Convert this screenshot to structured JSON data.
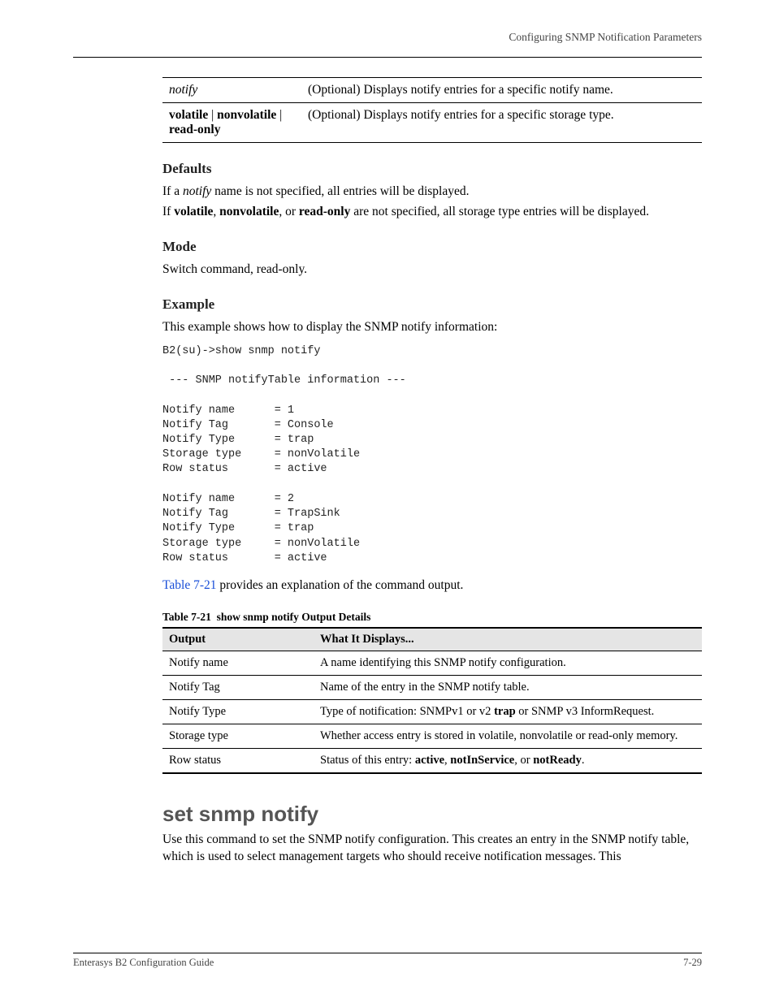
{
  "header": {
    "right_text": "Configuring SNMP Notification Parameters"
  },
  "param_table": {
    "rows": [
      {
        "key_html": "<span class=\"italic\">notify</span>",
        "desc": "(Optional) Displays notify entries for a specific notify name."
      },
      {
        "key_html": "<span class=\"bold\">volatile</span> | <span class=\"bold\">nonvolatile</span> | <span class=\"bold\">read-only</span>",
        "desc": "(Optional) Displays notify entries for a specific storage type."
      }
    ]
  },
  "defaults": {
    "heading": "Defaults",
    "line1_pre": "If a ",
    "line1_em": "notify",
    "line1_post": " name is not specified, all entries will be displayed.",
    "line2_pre": "If ",
    "line2_b1": "volatile",
    "line2_mid1": ", ",
    "line2_b2": "nonvolatile",
    "line2_mid2": ", or ",
    "line2_b3": "read-only",
    "line2_post": " are not specified, all storage type entries will be displayed."
  },
  "mode": {
    "heading": "Mode",
    "text": "Switch command, read-only."
  },
  "example": {
    "heading": "Example",
    "text": "This example shows how to display the SNMP notify information:",
    "term": "B2(su)->show snmp notify\n\n --- SNMP notifyTable information ---\n\nNotify name      = 1\nNotify Tag       = Console\nNotify Type      = trap\nStorage type     = nonVolatile\nRow status       = active\n\nNotify name      = 2\nNotify Tag       = TrapSink\nNotify Type      = trap\nStorage type     = nonVolatile\nRow status       = active"
  },
  "post_example": {
    "link_text": "Table 7-21",
    "rest": " provides an explanation of the command output."
  },
  "out_table": {
    "caption_ref": "Table 7-21",
    "caption_rest": "show snmp notify Output Details",
    "head_left": "Output",
    "head_right": "What It Displays...",
    "rows": [
      {
        "k": "Notify name",
        "v": "A name identifying this SNMP notify configuration."
      },
      {
        "k": "Notify Tag",
        "v": "Name of the entry in the SNMP notify table."
      },
      {
        "k": "Notify Type",
        "v_html": "Type of notification: SNMPv1 or v2 <span class=\"bold\">trap</span> or SNMP v3 InformRequest."
      },
      {
        "k": "Storage type",
        "v": "Whether access entry is stored in volatile, nonvolatile or read-only memory."
      },
      {
        "k": "Row status",
        "v_html": "Status of this entry: <span class=\"bold\">active</span>, <span class=\"bold\">notInService</span>, or <span class=\"bold\">notReady</span>."
      }
    ]
  },
  "next_cmd": {
    "heading": "set snmp notify",
    "text": "Use this command to set the SNMP notify configuration. This creates an entry in the SNMP notify table, which is used to select management targets who should receive notification messages. This"
  },
  "footer": {
    "left": "Enterasys B2 Configuration Guide",
    "right": "7-29"
  }
}
